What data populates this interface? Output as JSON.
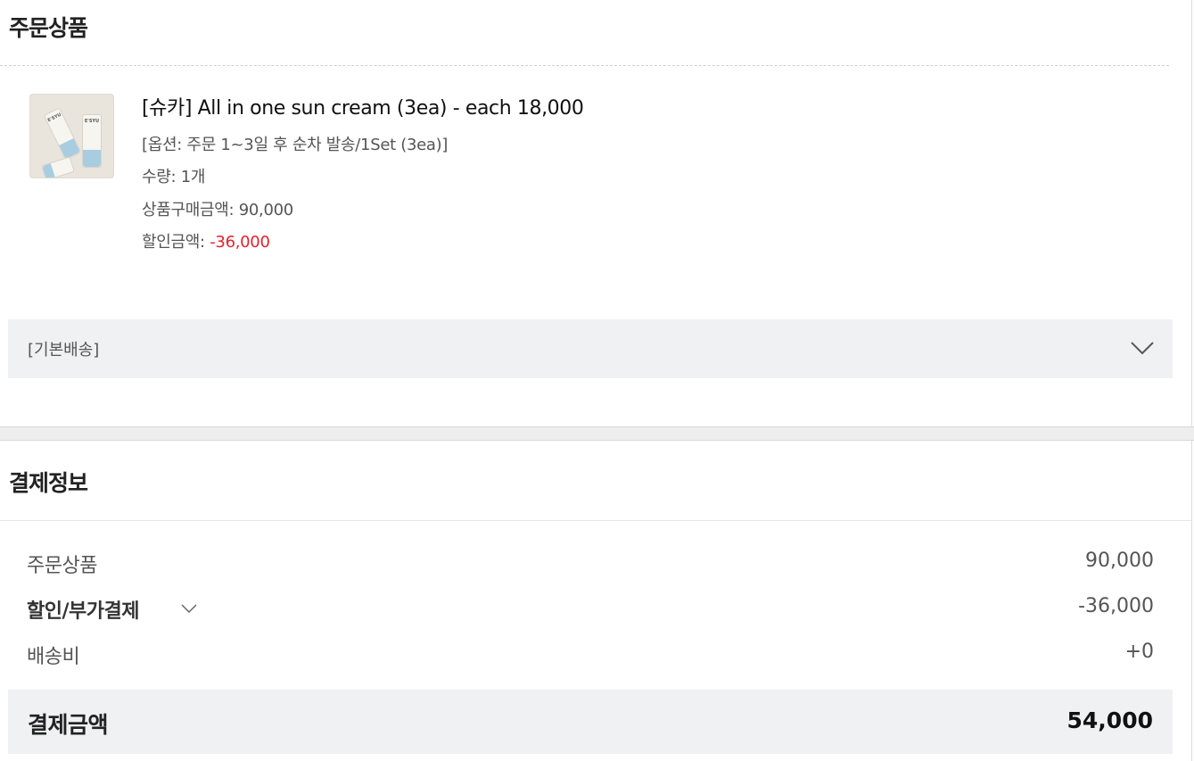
{
  "order_section": {
    "title": "주문상품",
    "item": {
      "thumbnail_brand": "E'SYU",
      "name": "[슈카] All in one sun cream (3ea) - each 18,000",
      "option": "[옵션: 주문 1~3일 후 순차 발송/1Set (3ea)]",
      "quantity": "수량: 1개",
      "purchase_amount_label": "상품구매금액: ",
      "purchase_amount": "90,000",
      "discount_label": "할인금액: ",
      "discount_amount": "-36,000"
    },
    "delivery": {
      "label": "[기본배송]",
      "icon": "chevron-down-icon"
    }
  },
  "payment_section": {
    "title": "결제정보",
    "rows": [
      {
        "label": "주문상품",
        "value": "90,000"
      },
      {
        "label": "할인/부가결제",
        "value": "-36,000",
        "icon": "chevron-down-icon"
      },
      {
        "label": "배송비",
        "value": "+0"
      }
    ],
    "total": {
      "label": "결제금액",
      "value": "54,000"
    }
  },
  "colors": {
    "discount_red": "#e8202c",
    "bar_background": "#f0f1f3"
  }
}
